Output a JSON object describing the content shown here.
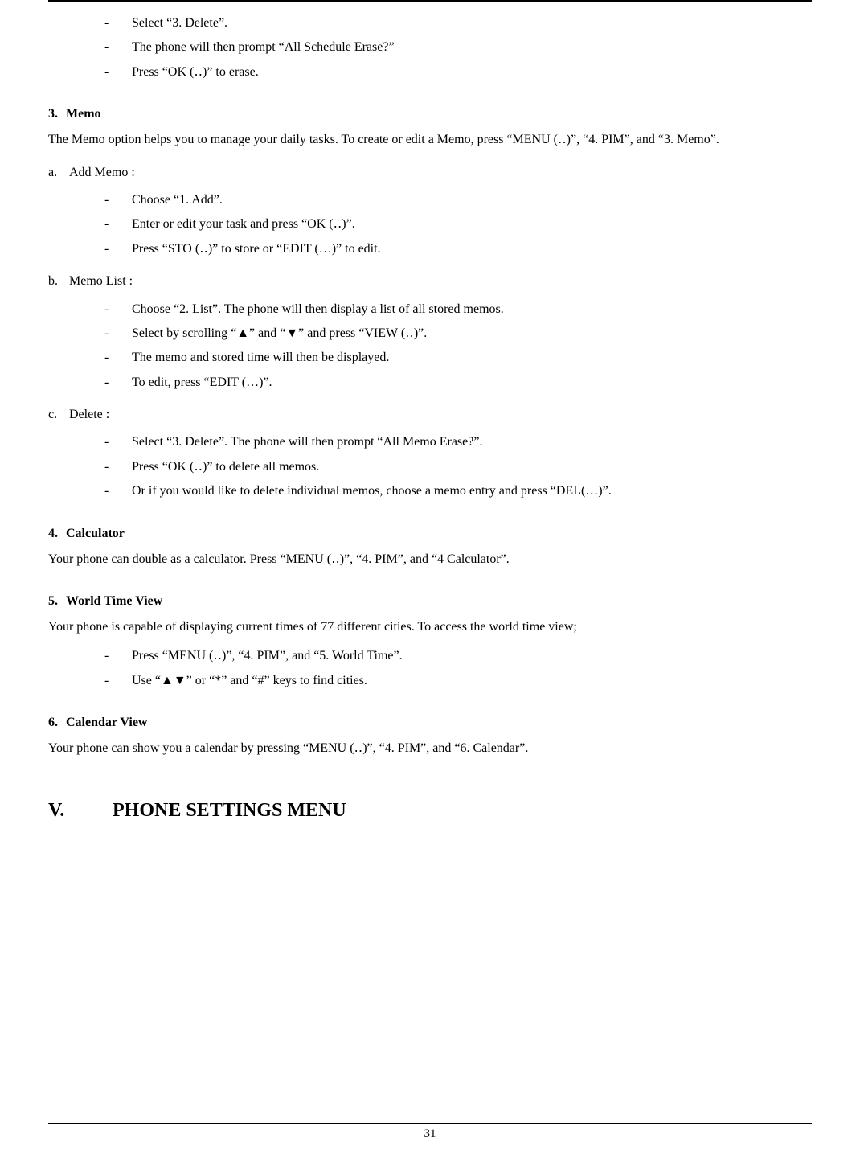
{
  "intro_bullets": [
    "Select “3. Delete”.",
    "The phone will then prompt “All Schedule Erase?”",
    "Press “OK (‥)” to erase."
  ],
  "sec3": {
    "num": "3.",
    "title": "Memo",
    "para": "The Memo option helps you to manage your daily tasks.    To create or edit a Memo, press “MENU (‥)”, “4. PIM”, and “3. Memo”.",
    "a": {
      "letter": "a.",
      "title": "Add Memo :",
      "items": [
        "Choose “1. Add”.",
        "Enter or edit your task and press “OK (‥)”.",
        "Press “STO (‥)” to store or “EDIT (…)” to edit."
      ]
    },
    "b": {
      "letter": "b.",
      "title": "Memo List :",
      "items": [
        "Choose “2. List”. The phone will then display a list of all stored memos.",
        "Select by scrolling “▲” and “▼” and press “VIEW (‥)”.",
        "The memo and stored time will then be displayed.",
        "To edit, press “EDIT (…)”."
      ]
    },
    "c": {
      "letter": "c.",
      "title": "Delete :",
      "items": [
        "Select “3. Delete”. The phone will then prompt “All Memo Erase?”.",
        "Press “OK (‥)” to delete all memos.",
        "Or if you would like to delete individual memos, choose a memo entry and press “DEL(…)”."
      ]
    }
  },
  "sec4": {
    "num": "4.",
    "title": "Calculator",
    "para": "Your phone can double as a calculator. Press “MENU (‥)”, “4. PIM”, and “4 Calculator”."
  },
  "sec5": {
    "num": "5.",
    "title": "World Time View",
    "para": "Your phone is capable of displaying current times of 77 different cities. To access the world time view;",
    "items": [
      "Press “MENU (‥)”, “4. PIM”, and “5. World Time”.",
      "Use “▲▼” or “*” and “#” keys to find cities."
    ]
  },
  "sec6": {
    "num": "6.",
    "title": "Calendar View",
    "para": "Your phone can show you a calendar by pressing “MENU (‥)”, “4. PIM”, and “6. Calendar”."
  },
  "bigheading": {
    "roman": "V.",
    "title": "PHONE SETTINGS MENU"
  },
  "page_number": "31"
}
